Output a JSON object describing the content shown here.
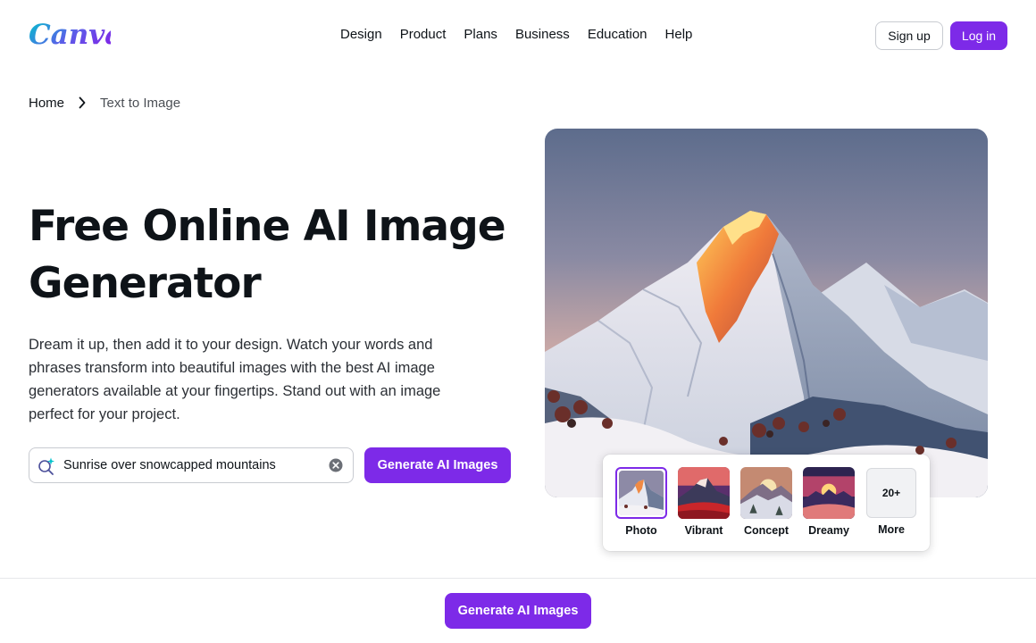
{
  "brand": {
    "logo_text": "Canva",
    "accent_color": "#7d2ae8"
  },
  "nav": {
    "items": [
      {
        "label": "Design"
      },
      {
        "label": "Product"
      },
      {
        "label": "Plans"
      },
      {
        "label": "Business"
      },
      {
        "label": "Education"
      },
      {
        "label": "Help"
      }
    ],
    "signup_label": "Sign up",
    "login_label": "Log in"
  },
  "breadcrumb": {
    "home": "Home",
    "current": "Text to Image",
    "separator_icon": "chevron-right-icon"
  },
  "hero": {
    "title": "Free Online AI Image Generator",
    "description": "Dream it up, then add it to your design. Watch your words and phrases transform into beautiful images with the best AI image generators available at your fingertips. Stand out with an image perfect for your project.",
    "search_value": "Sunrise over snowcapped mountains",
    "generate_label": "Generate AI Images",
    "image_alt": "Snowcapped mountain peak glowing orange at sunrise"
  },
  "styles": {
    "options": [
      {
        "label": "Photo",
        "selected": true
      },
      {
        "label": "Vibrant",
        "selected": false
      },
      {
        "label": "Concept",
        "selected": false
      },
      {
        "label": "Dreamy",
        "selected": false
      },
      {
        "label": "More",
        "badge": "20+",
        "selected": false
      }
    ]
  },
  "sticky": {
    "generate_label": "Generate AI Images"
  }
}
